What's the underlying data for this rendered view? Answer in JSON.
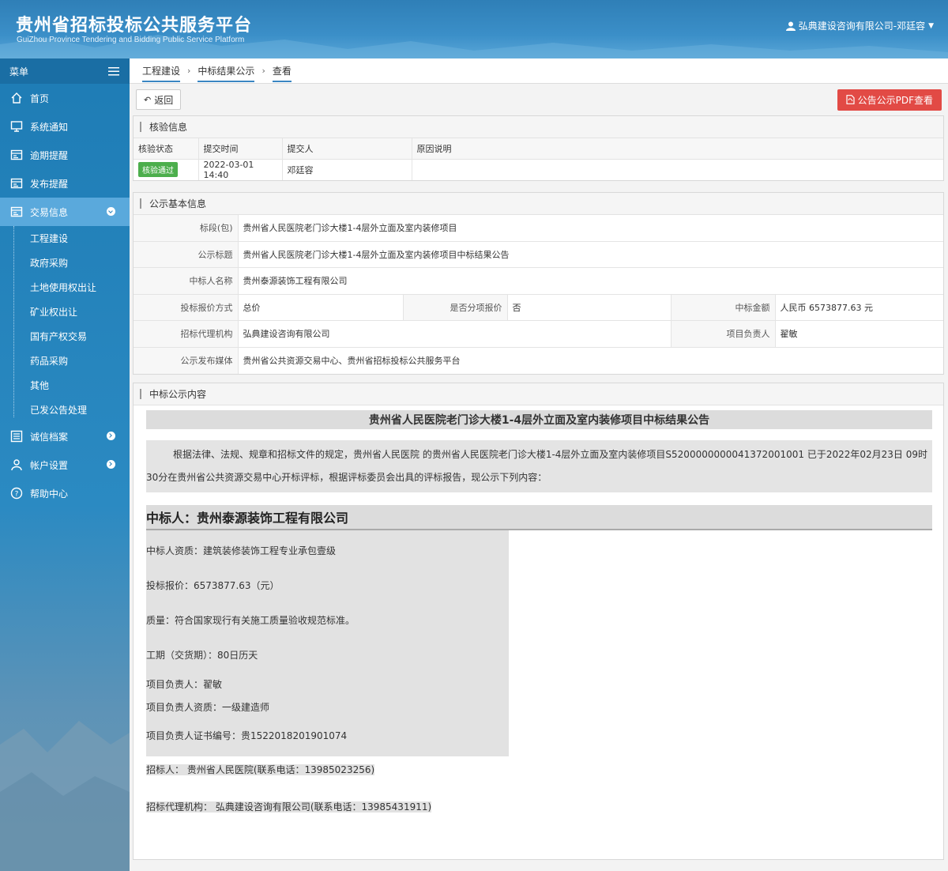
{
  "header": {
    "title_cn": "贵州省招标投标公共服务平台",
    "title_en": "GuiZhou Province Tendering and Bidding Public Service Platform",
    "user": "弘典建设咨询有限公司-邓廷容"
  },
  "sidebar": {
    "menu_label": "菜单",
    "items": [
      {
        "label": "首页",
        "icon": "home-icon"
      },
      {
        "label": "系统通知",
        "icon": "monitor-icon"
      },
      {
        "label": "逾期提醒",
        "icon": "calendar-icon"
      },
      {
        "label": "发布提醒",
        "icon": "calendar-icon"
      },
      {
        "label": "交易信息",
        "icon": "calendar-icon"
      },
      {
        "label": "诚信档案",
        "icon": "list-icon"
      },
      {
        "label": "帐户设置",
        "icon": "user-icon"
      },
      {
        "label": "帮助中心",
        "icon": "help-icon"
      }
    ],
    "sub_items": [
      "工程建设",
      "政府采购",
      "土地使用权出让",
      "矿业权出让",
      "国有产权交易",
      "药品采购",
      "其他",
      "已发公告处理"
    ]
  },
  "breadcrumb": [
    "工程建设",
    "中标结果公示",
    "查看"
  ],
  "toolbar": {
    "back_label": "返回",
    "pdf_label": "公告公示PDF查看"
  },
  "verify": {
    "title": "核验信息",
    "headers": [
      "核验状态",
      "提交时间",
      "提交人",
      "原因说明"
    ],
    "status": "核验通过",
    "time": "2022-03-01 14:40",
    "submitter": "邓廷容",
    "reason": ""
  },
  "basic": {
    "title": "公示基本信息",
    "section_label": "标段(包)",
    "section_value": "贵州省人民医院老门诊大楼1-4层外立面及室内装修项目",
    "notice_title_label": "公示标题",
    "notice_title_value": "贵州省人民医院老门诊大楼1-4层外立面及室内装修项目中标结果公告",
    "winner_label": "中标人名称",
    "winner_value": "贵州泰源装饰工程有限公司",
    "bid_method_label": "投标报价方式",
    "bid_method_value": "总价",
    "item_quote_label": "是否分项报价",
    "item_quote_value": "否",
    "amount_label": "中标金额",
    "amount_value": "人民币 6573877.63 元",
    "agency_label": "招标代理机构",
    "agency_value": "弘典建设咨询有限公司",
    "pm_label": "项目负责人",
    "pm_value": "翟敏",
    "media_label": "公示发布媒体",
    "media_value": "贵州省公共资源交易中心、贵州省招标投标公共服务平台"
  },
  "content": {
    "title": "中标公示内容",
    "doc_title": "贵州省人民医院老门诊大楼1-4层外立面及室内装修项目中标结果公告",
    "paragraph": "根据法律、法规、规章和招标文件的规定，贵州省人民医院 的贵州省人民医院老门诊大楼1-4层外立面及室内装修项目S5200000000041372001001 已于2022年02月23日 09时30分在贵州省公共资源交易中心开标评标，根据评标委员会出具的评标报告，现公示下列内容：",
    "winner_heading": "中标人：贵州泰源装饰工程有限公司",
    "lines": [
      "中标人资质：建筑装修装饰工程专业承包壹级",
      "投标报价：6573877.63（元）",
      "质量：符合国家现行有关施工质量验收规范标准。",
      "工期（交货期）：80日历天",
      "项目负责人：翟敏",
      "项目负责人资质：一级建造师",
      "项目负责人证书编号：贵1522018201901074"
    ],
    "tenderer": "招标人： 贵州省人民医院(联系电话：13985023256)",
    "agency": "招标代理机构： 弘典建设咨询有限公司(联系电话：13985431911)"
  }
}
